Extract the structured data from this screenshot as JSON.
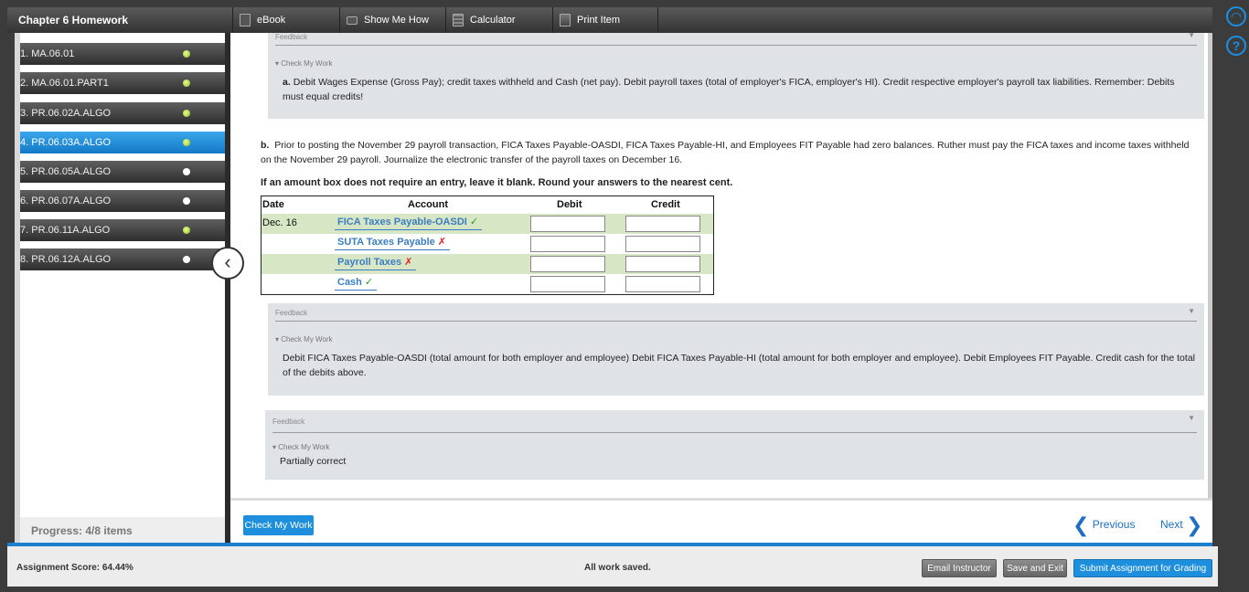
{
  "header": {
    "chapter_title": "Chapter 6 Homework",
    "tools": [
      {
        "label": "eBook",
        "icon": "book-icon"
      },
      {
        "label": "Show Me How",
        "icon": "video-camera-icon"
      },
      {
        "label": "Calculator",
        "icon": "calculator-icon"
      },
      {
        "label": "Print Item",
        "icon": "print-icon"
      }
    ]
  },
  "side_icons": {
    "help_chat": "headset-icon",
    "help": "?"
  },
  "questions": [
    {
      "label": "1. MA.06.01",
      "status": "done"
    },
    {
      "label": "2. MA.06.01.PART1",
      "status": "done"
    },
    {
      "label": "3. PR.06.02A.ALGO",
      "status": "done"
    },
    {
      "label": "4. PR.06.03A.ALGO",
      "status": "done",
      "active": true
    },
    {
      "label": "5. PR.06.05A.ALGO",
      "status": "todo"
    },
    {
      "label": "6. PR.06.07A.ALGO",
      "status": "todo"
    },
    {
      "label": "7. PR.06.11A.ALGO",
      "status": "done"
    },
    {
      "label": "8. PR.06.12A.ALGO",
      "status": "todo"
    }
  ],
  "progress": "Progress: 4/8 items",
  "feedback_top": {
    "title": "Feedback",
    "check_label": "Check My Work",
    "prefix": "a.",
    "text": "Debit Wages Expense (Gross Pay); credit taxes withheld and Cash (net pay). Debit payroll taxes (total of employer's FICA, employer's HI). Credit respective employer's payroll tax liabilities. Remember: Debits must equal credits!"
  },
  "part_b": {
    "prefix": "b.",
    "text": "Prior to posting the November 29 payroll transaction, FICA Taxes Payable-OASDI, FICA Taxes Payable-HI, and Employees FIT Payable had zero balances. Ruther must pay the FICA taxes and income taxes withheld on the November 29 payroll. Journalize the electronic transfer of the payroll taxes on December 16.",
    "instruction": "If an amount box does not require an entry, leave it blank. Round your answers to the nearest cent."
  },
  "journal": {
    "headers": {
      "date": "Date",
      "account": "Account",
      "debit": "Debit",
      "credit": "Credit"
    },
    "rows": [
      {
        "date": "Dec. 16",
        "account": "FICA Taxes Payable-OASDI",
        "mark": "✓",
        "correct": true,
        "debit": "",
        "credit": ""
      },
      {
        "date": "",
        "account": "SUTA Taxes Payable",
        "mark": "✗",
        "correct": false,
        "debit": "",
        "credit": ""
      },
      {
        "date": "",
        "account": "Payroll Taxes",
        "mark": "✗",
        "correct": false,
        "debit": "",
        "credit": ""
      },
      {
        "date": "",
        "account": "Cash",
        "mark": "✓",
        "correct": true,
        "debit": "",
        "credit": ""
      }
    ]
  },
  "feedback_b": {
    "title": "Feedback",
    "check_label": "Check My Work",
    "text": "Debit FICA Taxes Payable-OASDI (total amount for both employer and employee) Debit FICA Taxes Payable-HI (total amount for both employer and employee). Debit Employees FIT Payable. Credit cash for the total of the debits above."
  },
  "feedback_overall": {
    "title": "Feedback",
    "check_label": "Check My Work",
    "text": "Partially correct"
  },
  "nav": {
    "check_button": "Check My Work",
    "previous": "Previous",
    "next": "Next"
  },
  "footer": {
    "score": "Assignment Score: 64.44%",
    "saved": "All work saved.",
    "email": "Email Instructor",
    "save_exit": "Save and Exit",
    "submit": "Submit Assignment for Grading"
  },
  "colors": {
    "accent": "#1e8fdc",
    "correct": "#2a9a2a",
    "incorrect": "#e02020",
    "account_link": "#3a7ec2",
    "row_alt": "#d7e6c5"
  }
}
